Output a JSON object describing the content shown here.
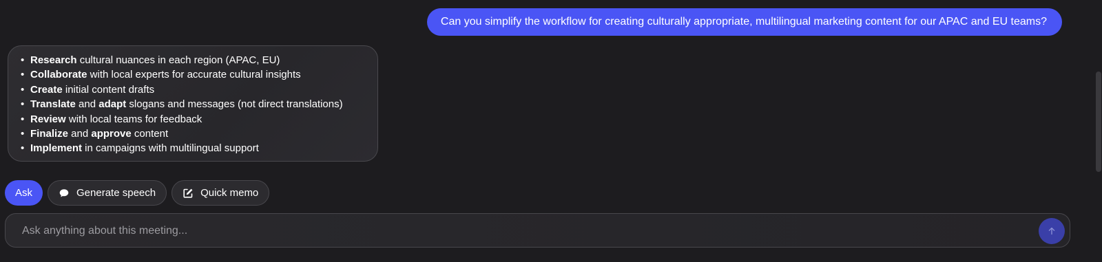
{
  "conversation": {
    "user_message": "Can you simplify the workflow for creating culturally appropriate, multilingual marketing content for our APAC and EU teams?",
    "reply_items": [
      {
        "parts": [
          {
            "text": "Research",
            "bold": true
          },
          {
            "text": " cultural nuances in each region (APAC, EU)",
            "bold": false
          }
        ]
      },
      {
        "parts": [
          {
            "text": "Collaborate",
            "bold": true
          },
          {
            "text": " with local experts for accurate cultural insights",
            "bold": false
          }
        ]
      },
      {
        "parts": [
          {
            "text": "Create",
            "bold": true
          },
          {
            "text": " initial content drafts",
            "bold": false
          }
        ]
      },
      {
        "parts": [
          {
            "text": "Translate",
            "bold": true
          },
          {
            "text": " and ",
            "bold": false
          },
          {
            "text": "adapt",
            "bold": true
          },
          {
            "text": " slogans and messages (not direct translations)",
            "bold": false
          }
        ]
      },
      {
        "parts": [
          {
            "text": "Review",
            "bold": true
          },
          {
            "text": " with local teams for feedback",
            "bold": false
          }
        ]
      },
      {
        "parts": [
          {
            "text": "Finalize",
            "bold": true
          },
          {
            "text": " and ",
            "bold": false
          },
          {
            "text": "approve",
            "bold": true
          },
          {
            "text": " content",
            "bold": false
          }
        ]
      },
      {
        "parts": [
          {
            "text": "Implement",
            "bold": true
          },
          {
            "text": " in campaigns with multilingual support",
            "bold": false
          }
        ]
      }
    ]
  },
  "actions": {
    "ask_label": "Ask",
    "generate_speech_label": "Generate speech",
    "generate_speech_icon": "speech-bubble-icon",
    "quick_memo_label": "Quick memo",
    "quick_memo_icon": "edit-note-icon"
  },
  "composer": {
    "placeholder": "Ask anything about this meeting...",
    "value": "",
    "send_icon": "arrow-up-icon"
  },
  "colors": {
    "accent": "#4a55f5",
    "background": "#1d1c1f",
    "send_button": "#3a3fa8"
  }
}
